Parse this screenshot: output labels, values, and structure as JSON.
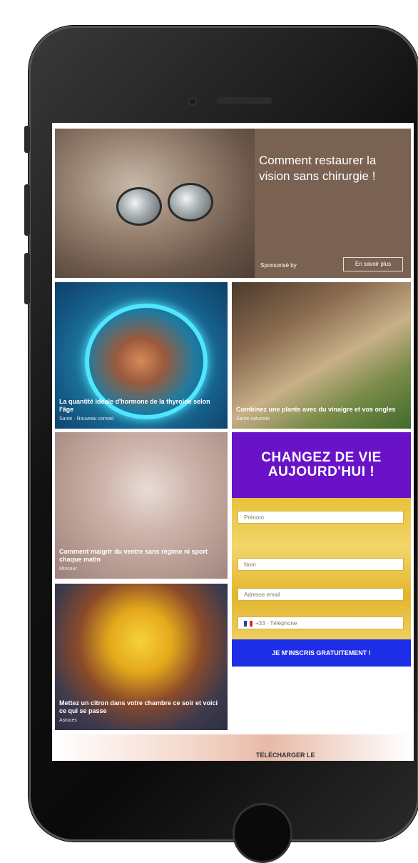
{
  "hero": {
    "headline": "Comment restaurer la vision sans chirurgie !",
    "sponsor": "Sponsorisé by",
    "button_label": "En savoir plus"
  },
  "tiles": [
    {
      "caption": "La quantité idéale d'hormone de la thyroïde selon l'âge",
      "source": "Santé · Nouveau conseil"
    },
    {
      "caption": "Combinez une plante avec du vinaigre et vos ongles",
      "source": "Santé naturelle"
    },
    {
      "caption": "Comment maigrir du ventre sans régime ni sport chaque matin",
      "source": "Minceur"
    },
    {
      "caption": "Mettez un citron dans votre chambre ce soir et voici ce qui se passe",
      "source": "Astuces"
    }
  ],
  "promo": {
    "title": "CHANGEZ DE VIE AUJOURD'HUI !",
    "fields": [
      "Prénom",
      "Nom",
      "Adresse email",
      "+33 · Téléphone"
    ],
    "cta_label": "JE M'INSCRIS GRATUITEMENT !"
  },
  "bottom": {
    "text": "TÉLÉCHARGER LE"
  },
  "colors": {
    "promo_header": "#6a12c8",
    "cta": "#1d2fe6",
    "form_bg": "#e9c13a"
  }
}
